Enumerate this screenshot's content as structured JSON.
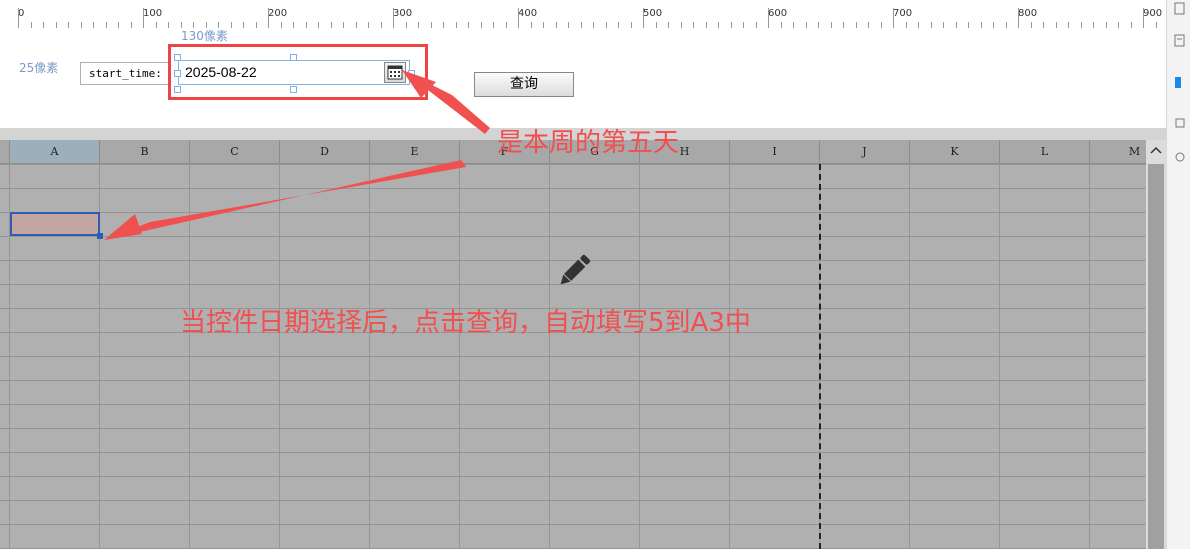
{
  "ruler": {
    "labels": [
      "0",
      "100",
      "200",
      "300",
      "400",
      "500",
      "600",
      "700",
      "800",
      "900"
    ]
  },
  "param_panel": {
    "height_hint": "25像素",
    "width_hint": "130像素",
    "label_text": "start_time:",
    "date_value": "2025-08-22",
    "query_label": "查询"
  },
  "sheet": {
    "columns": [
      "A",
      "B",
      "C",
      "D",
      "E",
      "F",
      "G",
      "H",
      "I",
      "J",
      "K",
      "L",
      "M"
    ],
    "selected_cell": "A3"
  },
  "annotations": {
    "fifth_day": "是本周的第五天",
    "instruction": "当控件日期选择后，点击查询，自动填写5到A3中"
  },
  "colors": {
    "annotation": "#f05050",
    "selection": "#2b5fb4",
    "widget_border": "#7fb2e5"
  },
  "icons": [
    "calendar-icon",
    "pencil-icon",
    "chevron-up-icon"
  ]
}
